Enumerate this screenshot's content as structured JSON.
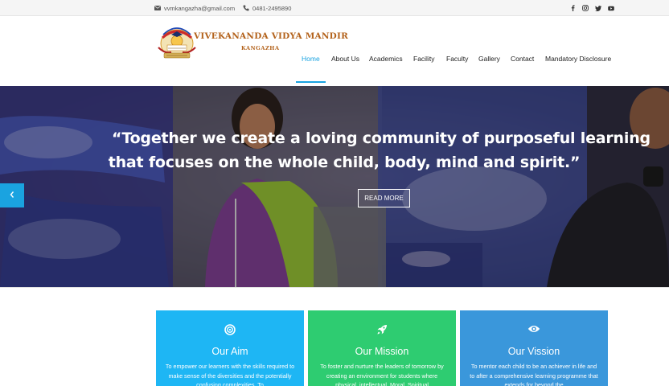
{
  "topbar": {
    "email": "vvmkangazha@gmail.com",
    "phone": "0481-2495890",
    "social_icons": [
      "facebook-icon",
      "instagram-icon",
      "twitter-icon",
      "youtube-icon"
    ]
  },
  "brand": {
    "name": "VIVEKANANDA VIDYA MANDIR",
    "location": "KANGAZHA",
    "color": "#b3621b"
  },
  "nav": {
    "items": [
      {
        "label": "Home",
        "active": true
      },
      {
        "label": "About Us"
      },
      {
        "label": "Academics"
      },
      {
        "label": "Facility"
      },
      {
        "label": "Faculty"
      },
      {
        "label": "Gallery"
      },
      {
        "label": "Contact"
      },
      {
        "label": "Mandatory Disclosure"
      }
    ],
    "accent": "#1aa3e0"
  },
  "hero": {
    "quote_line1": "“Together we create a loving community of purposeful learning",
    "quote_line2": "that focuses on the whole child, body, mind and spirit.”",
    "button_label": "READ MORE",
    "prev_icon": "chevron-left-icon"
  },
  "cards": [
    {
      "title": "Our Aim",
      "icon": "target-icon",
      "color": "#1eb6f4",
      "text": "To empower our learners with the skills required to make sense of the diversities and the potentially confusing complexities. To"
    },
    {
      "title": "Our Mission",
      "icon": "rocket-icon",
      "color": "#2ecc71",
      "text": "To foster and nurture the leaders of tomorrow by creating an environment for students where physical, intellectual, Moral, Spiritual"
    },
    {
      "title": "Our Vission",
      "icon": "eye-icon",
      "color": "#3a97db",
      "text": "To mentor each child to be an achiever in life and to after a comprehensive learning programme that extends for beyond the"
    }
  ]
}
